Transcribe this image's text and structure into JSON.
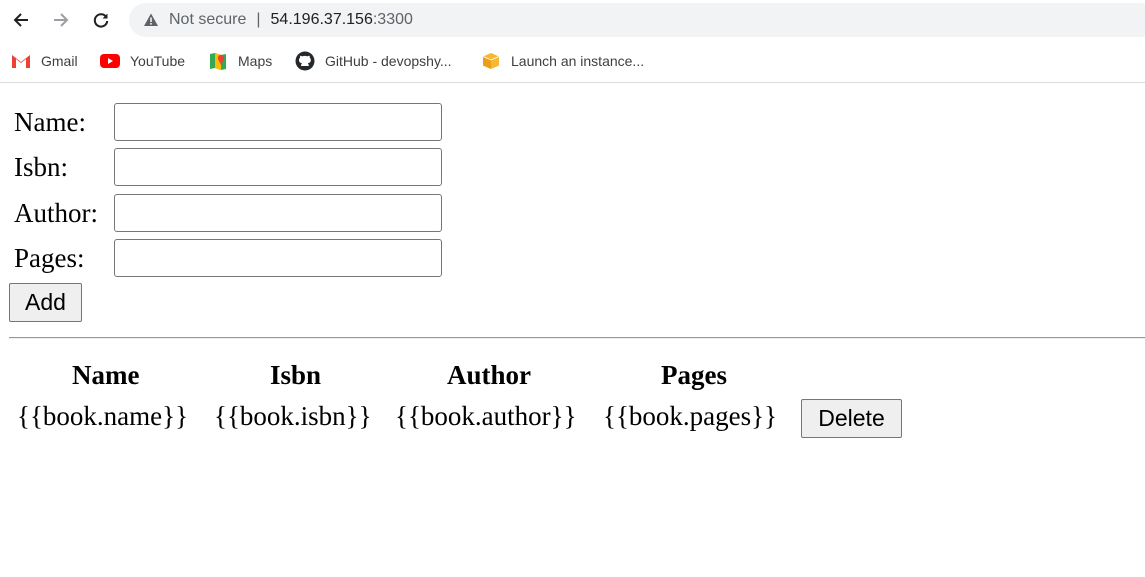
{
  "browser": {
    "security_label": "Not secure",
    "separator": "|",
    "host": "54.196.37.156",
    "port": ":3300"
  },
  "bookmarks": [
    {
      "label": "Gmail",
      "icon": "gmail-icon"
    },
    {
      "label": "YouTube",
      "icon": "youtube-icon"
    },
    {
      "label": "Maps",
      "icon": "maps-icon"
    },
    {
      "label": "GitHub - devopshy...",
      "icon": "github-icon"
    },
    {
      "label": "Launch an instance...",
      "icon": "aws-box-icon"
    }
  ],
  "form": {
    "name_label": "Name:",
    "isbn_label": "Isbn:",
    "author_label": "Author:",
    "pages_label": "Pages:",
    "name_value": "",
    "isbn_value": "",
    "author_value": "",
    "pages_value": "",
    "add_label": "Add"
  },
  "table": {
    "headers": [
      "Name",
      "Isbn",
      "Author",
      "Pages"
    ],
    "row": [
      "{{book.name}}",
      "{{book.isbn}}",
      "{{book.author}}",
      "{{book.pages}}"
    ],
    "delete_label": "Delete"
  }
}
